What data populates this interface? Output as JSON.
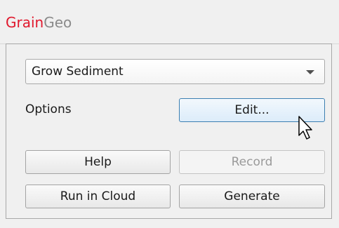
{
  "app": {
    "title_part1": "Grain",
    "title_part2": "Geo",
    "brand_color": "#e0182d"
  },
  "panel": {
    "operation_select": {
      "selected": "Grow Sediment",
      "icon": "chevron-down-icon"
    },
    "options_label": "Options",
    "buttons": {
      "edit": "Edit...",
      "help": "Help",
      "record": "Record",
      "run_in_cloud": "Run in Cloud",
      "generate": "Generate"
    },
    "record_enabled": false
  },
  "cursor": {
    "icon": "pointer-cursor-icon"
  }
}
